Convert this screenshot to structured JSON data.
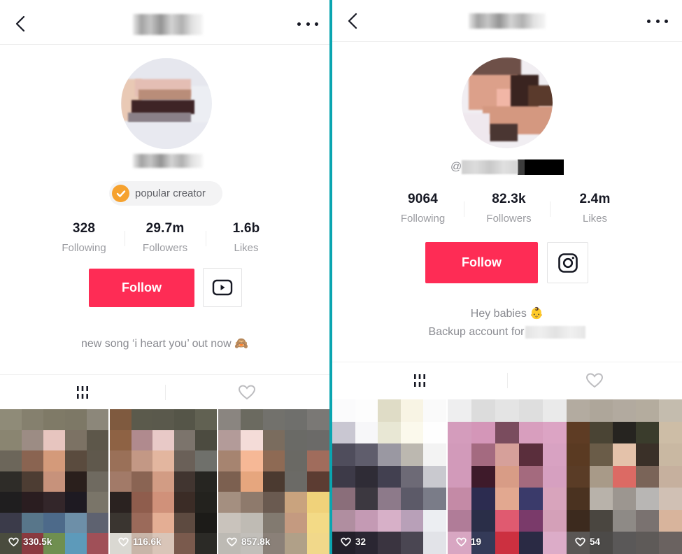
{
  "left_profile": {
    "header": {
      "title_redacted": true,
      "back_icon": "chevron-left-icon",
      "more_icon": "more-horizontal-icon"
    },
    "username_redacted": true,
    "badge": {
      "icon": "check-circle-icon",
      "label": "popular creator",
      "color": "#f6a22f"
    },
    "stats": [
      {
        "value": "328",
        "label": "Following"
      },
      {
        "value": "29.7m",
        "label": "Followers"
      },
      {
        "value": "1.6b",
        "label": "Likes"
      }
    ],
    "follow_label": "Follow",
    "follow_color": "#fe2c55",
    "social_icon": "youtube-icon",
    "bio": "new song ‘i heart you’ out now 🙈",
    "tabs": [
      {
        "icon": "videos-grid-icon"
      },
      {
        "icon": "liked-heart-icon"
      }
    ],
    "videos": [
      {
        "likes": "330.5k"
      },
      {
        "likes": "116.6k"
      },
      {
        "likes": "857.8k"
      }
    ]
  },
  "right_profile": {
    "header": {
      "title_redacted": true,
      "back_icon": "chevron-left-icon",
      "more_icon": "more-horizontal-icon"
    },
    "handle_prefix": "@",
    "handle_redacted": true,
    "stats": [
      {
        "value": "9064",
        "label": "Following"
      },
      {
        "value": "82.3k",
        "label": "Followers"
      },
      {
        "value": "2.4m",
        "label": "Likes"
      }
    ],
    "follow_label": "Follow",
    "follow_color": "#fe2c55",
    "social_icon": "instagram-icon",
    "bio_line1": "Hey babies 👶",
    "bio_line2": "Backup account for",
    "tabs": [
      {
        "icon": "videos-grid-icon"
      },
      {
        "icon": "liked-heart-icon"
      }
    ],
    "videos": [
      {
        "likes": "32"
      },
      {
        "likes": "19"
      },
      {
        "likes": "54"
      }
    ]
  },
  "divider_color": "#0aa5b0"
}
